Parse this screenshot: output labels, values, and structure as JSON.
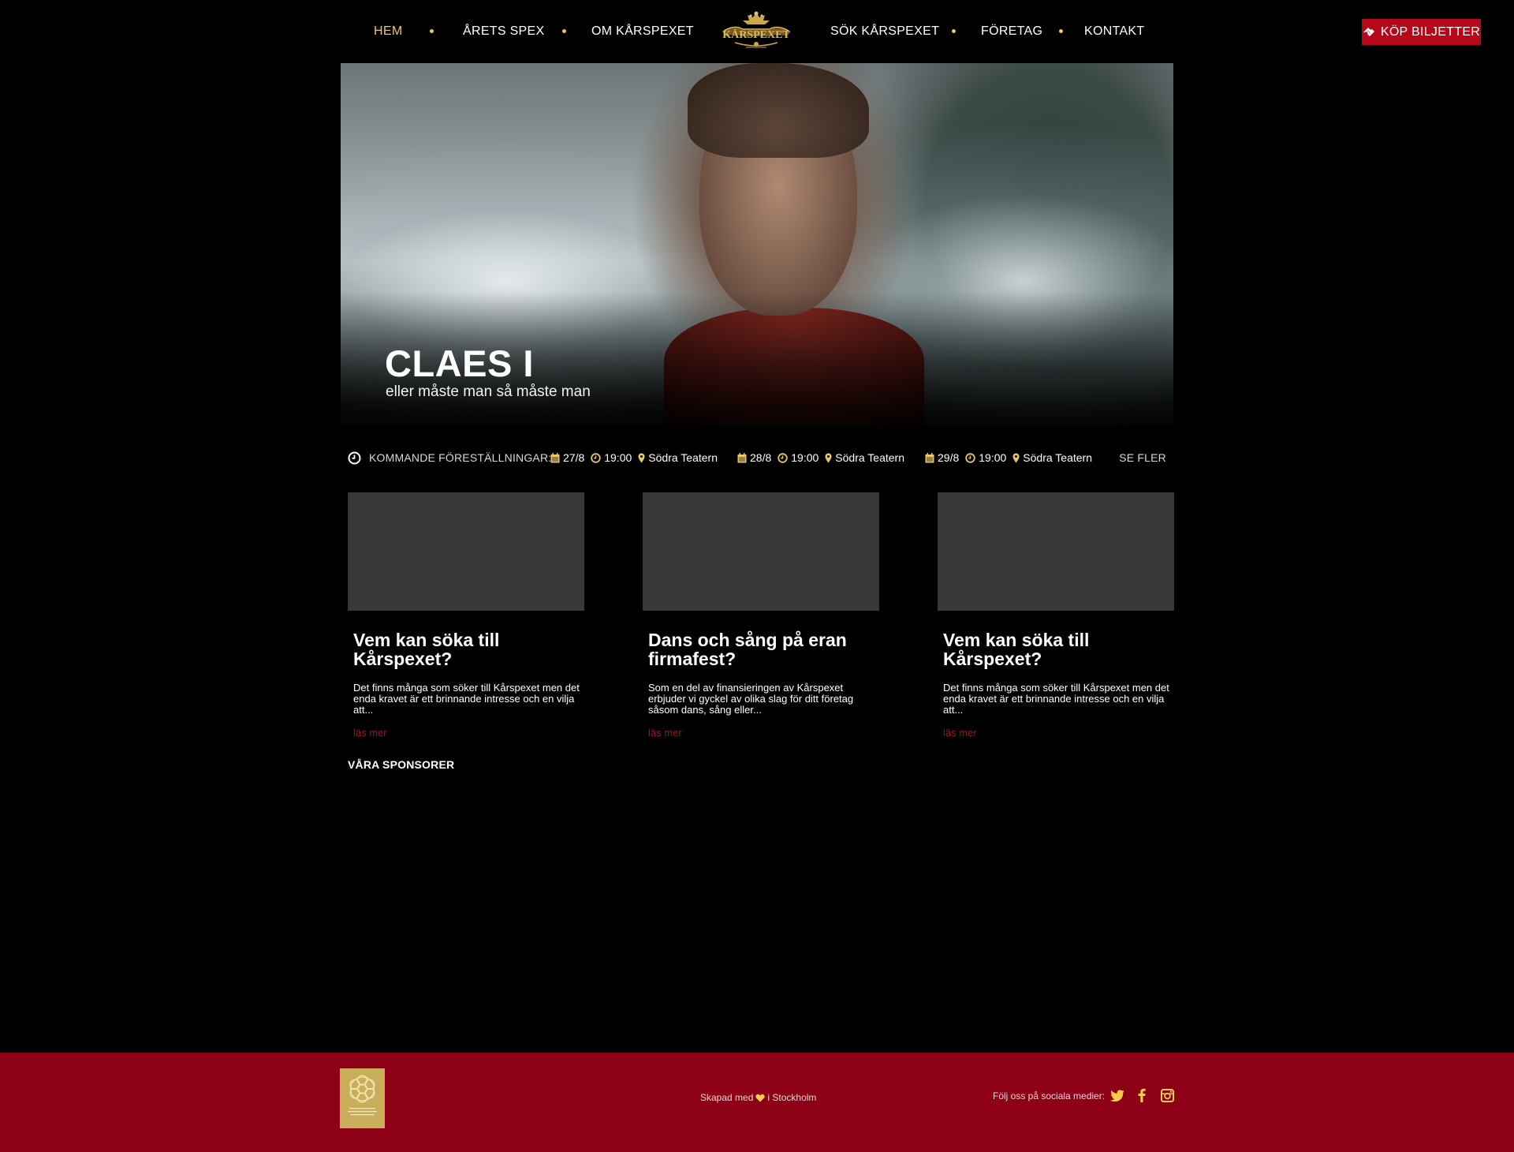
{
  "nav": {
    "items": [
      {
        "label": "HEM",
        "active": true
      },
      {
        "label": "ÅRETS SPEX",
        "active": false
      },
      {
        "label": "OM KÅRSPEXET",
        "active": false
      },
      {
        "label": "SÖK KÅRSPEXET",
        "active": false
      },
      {
        "label": "FÖRETAG",
        "active": false
      },
      {
        "label": "KONTAKT",
        "active": false
      }
    ],
    "logo_text": "KÅRSPEXET",
    "buy_button": "KÖP BILJETTER",
    "accent_color": "#e8c766",
    "button_color": "#b5081a"
  },
  "hero": {
    "title": "CLAES I",
    "subtitle": "eller måste man så måste man"
  },
  "shows": {
    "label": "KOMMANDE FÖRESTÄLLNINGAR:",
    "items": [
      {
        "date": "27/8",
        "time": "19:00",
        "venue": "Södra Teatern"
      },
      {
        "date": "28/8",
        "time": "19:00",
        "venue": "Södra Teatern"
      },
      {
        "date": "29/8",
        "time": "19:00",
        "venue": "Södra Teatern"
      }
    ],
    "more": "SE FLER",
    "icons": [
      "clock-icon",
      "calendar-icon",
      "clock-icon",
      "location-pin-icon"
    ]
  },
  "cards": [
    {
      "title": "Vem kan söka till Kårspexet?",
      "text": "Det finns många som söker till Kårspexet men det enda kravet är ett brinnande intresse och en vilja att...",
      "more": "läs mer"
    },
    {
      "title": "Dans och sång på eran firmafest?",
      "text": "Som en del av finansieringen av Kårspexet erbjuder vi gyckel av olika slag för ditt företag såsom dans, sång eller...",
      "more": "läs mer"
    },
    {
      "title": "Vem kan söka till Kårspexet?",
      "text": "Det finns många som söker till Kårspexet men det enda kravet är ett brinnande intresse och en vilja att...",
      "more": "läs mer"
    }
  ],
  "sponsors": {
    "heading": "VÅRA SPONSORER"
  },
  "footer": {
    "logo_text": "TEKNISKA HÖGSKOLANS STUDENTKÅR",
    "credit_before": "Skapad med",
    "credit_after": "i Stockholm",
    "follow_label": "Följ oss på sociala medier:",
    "social": [
      "twitter-icon",
      "facebook-icon",
      "instagram-icon"
    ],
    "background_color": "#8d0016"
  }
}
